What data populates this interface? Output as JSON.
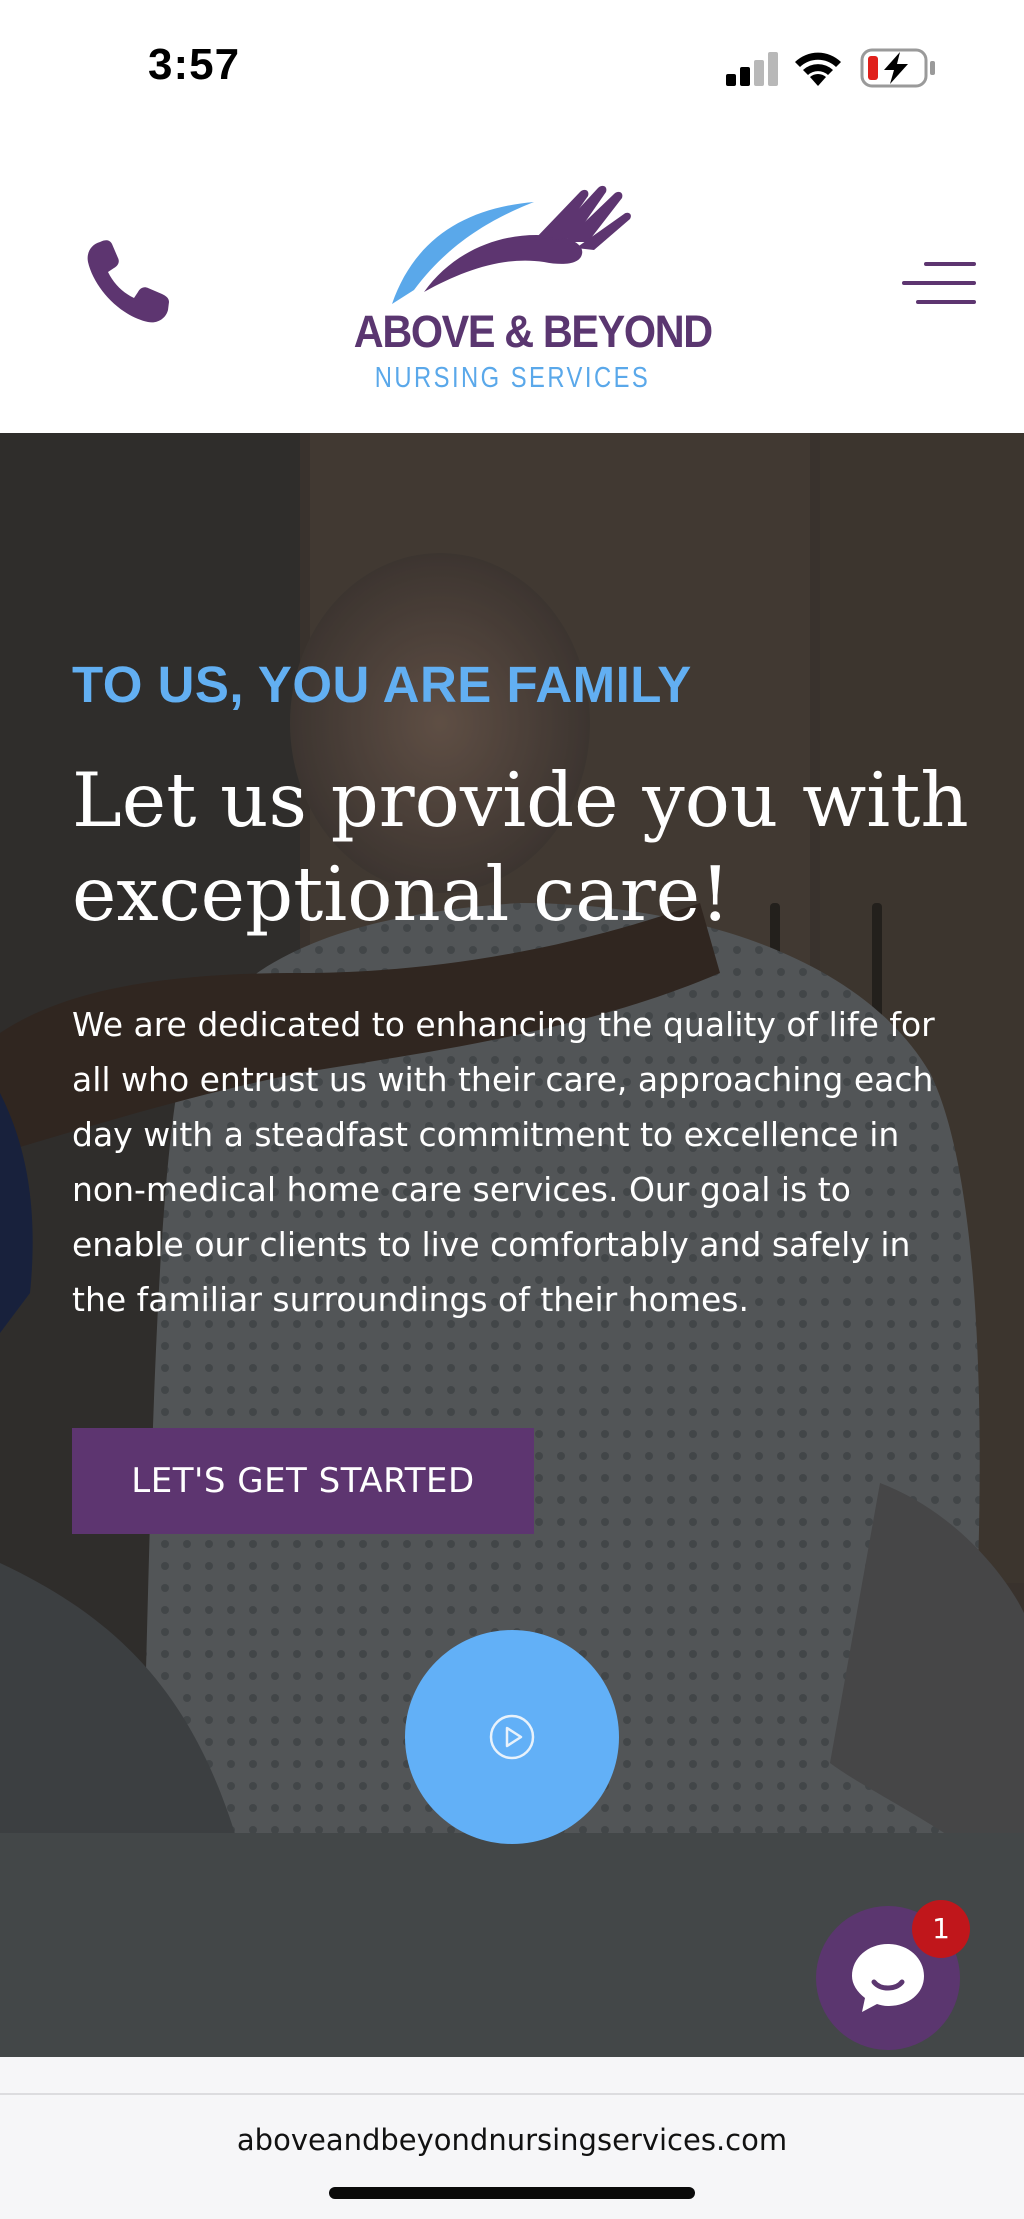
{
  "status_bar": {
    "time": "3:57",
    "icons": [
      "signal-icon",
      "wifi-icon",
      "battery-charging-icon"
    ]
  },
  "header": {
    "logo": {
      "title": "ABOVE & BEYOND",
      "subtitle": "NURSING SERVICES"
    },
    "icons": {
      "call": "phone-icon",
      "menu": "hamburger-menu-icon"
    }
  },
  "hero": {
    "eyebrow": "TO US, YOU ARE FAMILY",
    "headline": "Let us provide you with exceptional care!",
    "body": "We are dedicated to enhancing the quality of life for all who entrust us with their care, approaching each day with a steadfast commitment to excellence in non-medical home care services. Our goal is to enable our clients to live comfortably and safely in the familiar surroundings of their homes.",
    "cta_label": "LET'S GET STARTED",
    "play_icon": "play-circle-icon"
  },
  "chat": {
    "icon": "chat-bubble-icon",
    "badge_count": "1"
  },
  "browser": {
    "url": "aboveandbeyondnursingservices.com"
  },
  "colors": {
    "brand_purple": "#5d3570",
    "accent_blue": "#62aff2",
    "badge_red": "#c0161b"
  }
}
